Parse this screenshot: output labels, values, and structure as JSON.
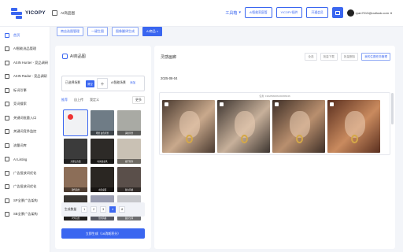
{
  "app": {
    "logo_text": "YICOPY",
    "breadcrumb": "AI商品图"
  },
  "header": {
    "tools_label": "工具箱",
    "btn_ai_skill": "AI智能家庭管",
    "btn_plugin": "YICOPY插件",
    "btn_member": "开通会员",
    "user_email": "ryan7013@outlook.com"
  },
  "sidebar": {
    "items": [
      {
        "label": "首页"
      },
      {
        "label": "AI智能选品管理"
      },
      {
        "label": "ASIN Hunter - 竞品调研"
      },
      {
        "label": "ASIN Radar - 竞品调研"
      },
      {
        "label": "标词引擎"
      },
      {
        "label": "竞词搜索"
      },
      {
        "label": "关键词批量入口"
      },
      {
        "label": "关键词竞争监控"
      },
      {
        "label": "流量词库"
      },
      {
        "label": "AI Listing"
      },
      {
        "label": "广告投放词优化"
      },
      {
        "label": "广告投放词优化"
      },
      {
        "label": "SP全景广告架构"
      },
      {
        "label": "SB全景广告架构"
      }
    ]
  },
  "tabs": [
    {
      "label": "商店选图管理",
      "active": false
    },
    {
      "label": "一键生图",
      "active": false
    },
    {
      "label": "图像翻译生成",
      "active": false
    },
    {
      "label": "AI商品 ×",
      "active": true
    }
  ],
  "left_panel": {
    "title": "AI商品图",
    "select_label": "已选择场景",
    "select_button": "清空",
    "model_label": "AI智能场景",
    "toggle_label": "添加",
    "subtabs": [
      "推荐",
      "自上传",
      "我定义"
    ],
    "more_label": "更多",
    "thumbs": [
      {
        "caption": "",
        "color": "#f1f2f4"
      },
      {
        "caption": "场景 白色背景",
        "color": "#6f7c86"
      },
      {
        "caption": "清新背景",
        "color": "#a9aaa4"
      },
      {
        "caption": "大理石台面",
        "color": "#3b3b3b"
      },
      {
        "caption": "时尚商业风",
        "color": "#2d2a27"
      },
      {
        "caption": "客厅陈列",
        "color": "#c9c1b4"
      },
      {
        "caption": "现代简约",
        "color": "#8c6e58"
      },
      {
        "caption": "木质桌面",
        "color": "#2a2622"
      },
      {
        "caption": "复古风格",
        "color": "#5a4f4a"
      },
      {
        "caption": "户外自然",
        "color": "#3a3632"
      },
      {
        "caption": "室内风格",
        "color": "#9a9db0"
      },
      {
        "caption": "展示空间",
        "color": "#c7c8cc"
      }
    ],
    "gen_count_label": "生成数量",
    "counts": [
      "1",
      "2",
      "3",
      "4",
      "8"
    ],
    "selected_count": "4",
    "generate_button": "立即生成（16消耗积分）"
  },
  "right_panel": {
    "title": "灵感画廊",
    "actions": [
      "全选",
      "批量下载",
      "批量删除",
      "我的生图任务管理"
    ],
    "date": "2025-08-04",
    "result_id": "任务: 1902838466161866046",
    "photos": [
      {
        "color_a": "#4a3a30",
        "color_b": "#c9a98c"
      },
      {
        "color_a": "#3d3530",
        "color_b": "#c7b09a"
      },
      {
        "color_a": "#3e2f27",
        "color_b": "#b98f6e"
      },
      {
        "color_a": "#5a2f1f",
        "color_b": "#c98a5e"
      }
    ]
  },
  "colors": {
    "accent": "#3a66f0",
    "background": "#f3f5f9"
  }
}
